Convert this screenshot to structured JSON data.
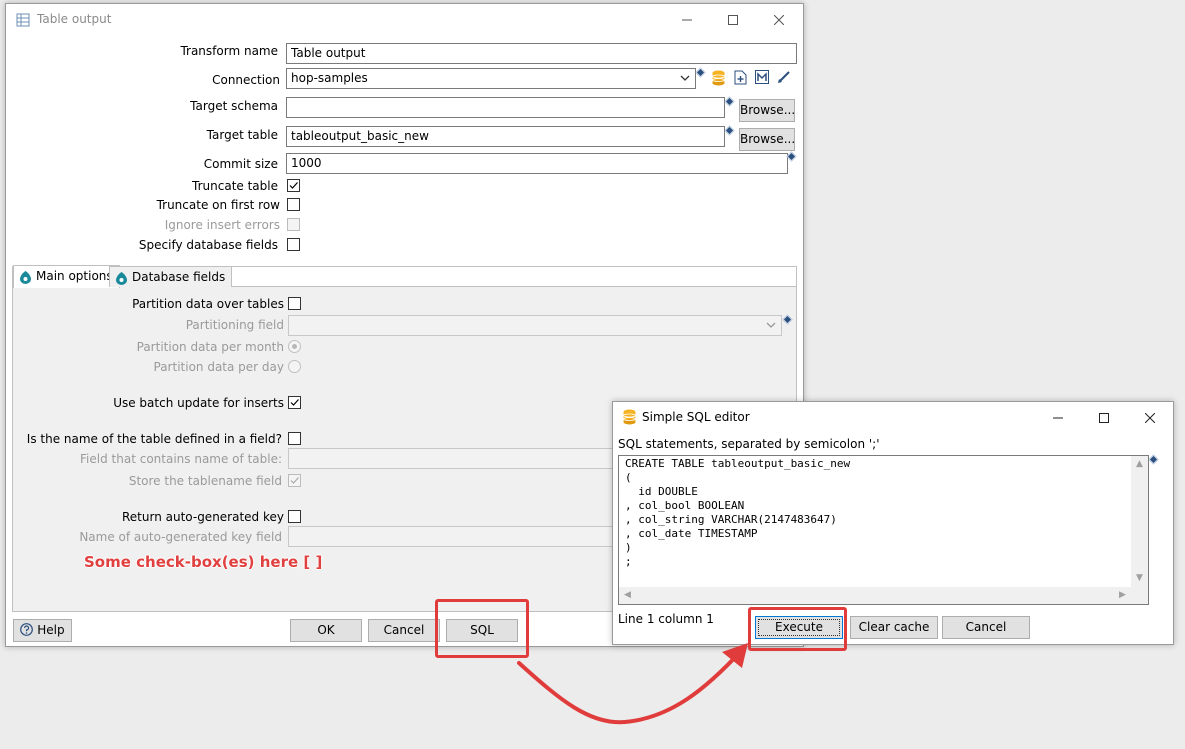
{
  "table_output": {
    "title": "Table output",
    "fields": {
      "transform_name_label": "Transform name",
      "transform_name_value": "Table output",
      "connection_label": "Connection",
      "connection_value": "hop-samples",
      "target_schema_label": "Target schema",
      "target_schema_value": "",
      "target_table_label": "Target table",
      "target_table_value": "tableoutput_basic_new",
      "commit_size_label": "Commit size",
      "commit_size_value": "1000",
      "browse_label": "Browse..."
    },
    "checks": {
      "truncate_table_label": "Truncate table",
      "truncate_first_row_label": "Truncate on first row",
      "ignore_errors_label": "Ignore insert errors",
      "specify_fields_label": "Specify database fields"
    },
    "tabs": [
      "Main options",
      "Database fields"
    ],
    "main_options": {
      "partition_label": "Partition data over tables",
      "partitioning_field_label": "Partitioning field",
      "per_month_label": "Partition data per month",
      "per_day_label": "Partition data per day",
      "batch_label": "Use batch update for inserts",
      "table_in_field_label": "Is the name of the table defined in a field?",
      "field_name_label": "Field that contains name of table:",
      "store_name_label": "Store the tablename field",
      "return_key_label": "Return auto-generated key",
      "key_field_label": "Name of auto-generated key field"
    },
    "annotation_text": "Some check-box(es) here [  ]",
    "buttons": {
      "help": "Help",
      "ok": "OK",
      "cancel": "Cancel",
      "sql": "SQL"
    }
  },
  "sql_editor": {
    "title": "Simple SQL editor",
    "statements_label": "SQL statements, separated by semicolon ';'",
    "sql": "CREATE TABLE tableoutput_basic_new\n(\n  id DOUBLE\n, col_bool BOOLEAN\n, col_string VARCHAR(2147483647)\n, col_date TIMESTAMP\n)\n;",
    "status": "Line 1 column 1",
    "buttons": {
      "execute": "Execute",
      "clear_cache": "Clear cache",
      "cancel": "Cancel"
    }
  },
  "colors": {
    "annotation_red": "#e03c3c",
    "variable_marker": "#2b4f7e",
    "default_button_border": "#0078d7"
  }
}
